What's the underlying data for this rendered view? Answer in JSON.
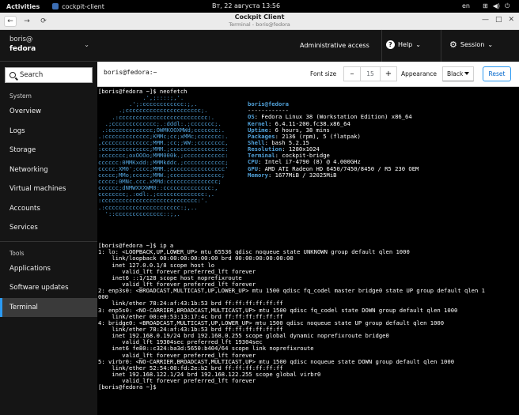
{
  "topbar": {
    "activities": "Activities",
    "app_name": "cockpit-client",
    "clock": "Вт, 22 августа  13:56",
    "lang": "en",
    "tray": [
      "⊞",
      "◀)",
      "⏻"
    ]
  },
  "browser": {
    "title": "Cockpit Client",
    "subtitle": "Terminal - boris@fedora",
    "win_buttons": [
      "—",
      "□",
      "✕"
    ]
  },
  "sidebar": {
    "user": "boris@",
    "hostname": "fedora",
    "search_placeholder": "Search",
    "system_label": "System",
    "system_items": [
      "Overview",
      "Logs",
      "Storage",
      "Networking",
      "Virtual machines",
      "Accounts",
      "Services"
    ],
    "tools_label": "Tools",
    "tools_items": [
      "Applications",
      "Software updates",
      "Terminal"
    ],
    "active": "Terminal"
  },
  "masthead": {
    "admin": "Administrative access",
    "help": "Help",
    "session": "Session"
  },
  "toolbar": {
    "title": "boris@fedora:~",
    "font_size_label": "Font size",
    "font_size_value": "15",
    "minus": "–",
    "plus": "+",
    "appearance_label": "Appearance",
    "appearance_value": "Black",
    "reset": "Reset"
  },
  "terminal": {
    "cmd1": "[boris@fedora ~]$ neofetch",
    "logo": [
      "             .',;::::;,'.",
      "         .';:cccccccccccc:;,.",
      "      .;cccccccccccccccccccccc;.",
      "    .:cccccccccccccccccccccccccc:.",
      "  .;ccccccccccccc;.:dddl:.;ccccccc;.",
      " .:ccccccccccccc;OWMKOOXMWd;ccccccc:.",
      ".:ccccccccccccc;KMMc;cc;xMMc;ccccccc:.",
      ",cccccccccccccc;MMM.;cc;;WW:;cccccccc,",
      ":cccccccccccccc;MMM.;cccccccccccccccc:",
      ":ccccccc;oxOOOo;MMM000k.;cccccccccccc:",
      "cccccc:0MMKxdd:;MMMkddc.;cccccccccccc;",
      "ccccc:XM0';cccc;MMM.;cccccccccccccccc'",
      "ccccc;MMo;ccccc;MMW.;ccccccccccccccc;",
      "ccccc;0MNc.ccc.xMMd:ccccccccccccccc;",
      "cccccc;dNMWXXXWM0::cccccccccccccc:,",
      "cccccccc;.:odl:.;cccccccccccccc:,.",
      ":cccccccccccccccccccccccccccc:'.",
      ".:cccccccccccccccccccccc:;,..",
      "  '::cccccccccccccc::;,."
    ],
    "header": "boris@fedora",
    "separator": "------------",
    "info": [
      {
        "k": "OS",
        "v": "Fedora Linux 38 (Workstation Edition) x86_64"
      },
      {
        "k": "Kernel",
        "v": "6.4.11-200.fc38.x86_64"
      },
      {
        "k": "Uptime",
        "v": "6 hours, 38 mins"
      },
      {
        "k": "Packages",
        "v": "2136 (rpm), 5 (flatpak)"
      },
      {
        "k": "Shell",
        "v": "bash 5.2.15"
      },
      {
        "k": "Resolution",
        "v": "1280x1024"
      },
      {
        "k": "Terminal",
        "v": "cockpit-bridge"
      },
      {
        "k": "CPU",
        "v": "Intel i7-4790 (8) @ 4.000GHz"
      },
      {
        "k": "GPU",
        "v": "AMD ATI Radeon HD 6450/7450/8450 / R5 230 OEM"
      },
      {
        "k": "Memory",
        "v": "1677MiB / 32025MiB"
      }
    ],
    "output": [
      "[boris@fedora ~]$ ip a",
      "1: lo: <LOOPBACK,UP,LOWER_UP> mtu 65536 qdisc noqueue state UNKNOWN group default qlen 1000",
      "    link/loopback 00:00:00:00:00:00 brd 00:00:00:00:00:00",
      "    inet 127.0.0.1/8 scope host lo",
      "       valid_lft forever preferred_lft forever",
      "    inet6 ::1/128 scope host noprefixroute",
      "       valid_lft forever preferred_lft forever",
      "2: enp3s0: <BROADCAST,MULTICAST,UP,LOWER_UP> mtu 1500 qdisc fq_codel master bridge0 state UP group default qlen 1",
      "000",
      "    link/ether 78:24:af:43:1b:53 brd ff:ff:ff:ff:ff:ff",
      "3: enp5s0: <NO-CARRIER,BROADCAST,MULTICAST,UP> mtu 1500 qdisc fq_codel state DOWN group default qlen 1000",
      "    link/ether 00:e0:53:13:17:4c brd ff:ff:ff:ff:ff:ff",
      "4: bridge0: <BROADCAST,MULTICAST,UP,LOWER_UP> mtu 1500 qdisc noqueue state UP group default qlen 1000",
      "    link/ether 78:24:af:43:1b:53 brd ff:ff:ff:ff:ff:ff",
      "    inet 192.168.0.19/24 brd 192.168.0.255 scope global dynamic noprefixroute bridge0",
      "       valid_lft 19304sec preferred_lft 19304sec",
      "    inet6 fe80::c324:ba3d:5650:b404/64 scope link noprefixroute",
      "       valid_lft forever preferred_lft forever",
      "5: virbr0: <NO-CARRIER,BROADCAST,MULTICAST,UP> mtu 1500 qdisc noqueue state DOWN group default qlen 1000",
      "    link/ether 52:54:00:fd:2e:b2 brd ff:ff:ff:ff:ff:ff",
      "    inet 192.168.122.1/24 brd 192.168.122.255 scope global virbr0",
      "       valid_lft forever preferred_lft forever",
      "[boris@fedora ~]$ "
    ]
  }
}
